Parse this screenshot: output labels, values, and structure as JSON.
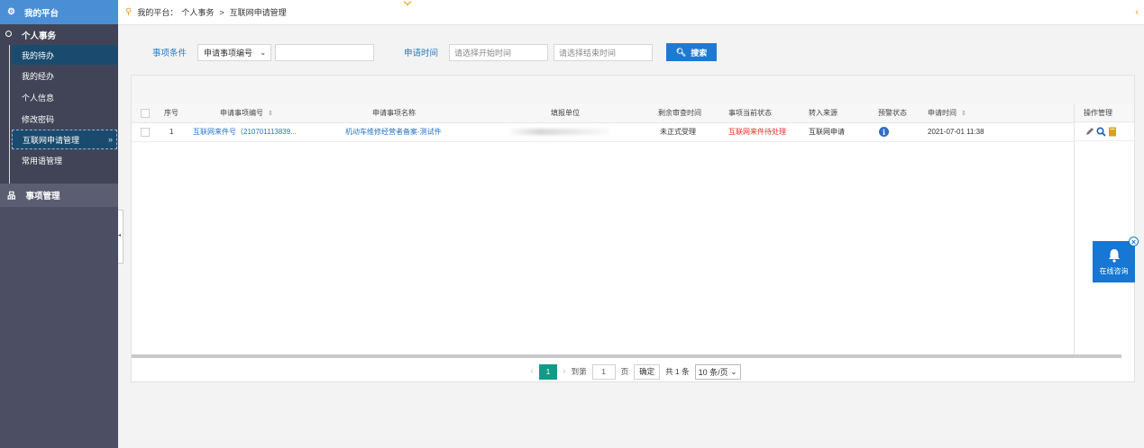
{
  "sidebar": {
    "platform": "我的平台",
    "group1": {
      "title": "个人事务",
      "items": [
        {
          "label": "我的待办"
        },
        {
          "label": "我的经办"
        },
        {
          "label": "个人信息"
        },
        {
          "label": "修改密码"
        },
        {
          "label": "互联网申请管理",
          "arrow": "»"
        },
        {
          "label": "常用语管理"
        }
      ]
    },
    "group2": {
      "title": "事项管理"
    }
  },
  "breadcrumb": {
    "root": "我的平台：",
    "level1": "个人事务",
    "separator": ">",
    "level2": "互联网申请管理",
    "back_icon": "‹"
  },
  "search": {
    "condition_label": "事项条件",
    "condition_select": "申请事项编号",
    "condition_value": "",
    "time_label": "申请时间",
    "start_placeholder": "请选择开始时间",
    "end_placeholder": "请选择结束时间",
    "search_button": "搜索"
  },
  "table": {
    "headers": {
      "index": "序号",
      "code": "申请事项编号",
      "name": "申请事项名称",
      "unit": "填报单位",
      "remaining": "剩余审查时间",
      "status": "事项当前状态",
      "source": "转入来源",
      "warning": "预警状态",
      "time": "申请时间",
      "ops": "操作管理"
    },
    "sort_icon": "⇕",
    "rows": [
      {
        "index": "1",
        "code": "互联网来件号（210701113839...",
        "name": "机动车维修经营者备案-测试件",
        "remaining": "未正式受理",
        "status": "互联网来件待处理",
        "source": "互联网申请",
        "warning_icon": "i",
        "time": "2021-07-01 11:38"
      }
    ]
  },
  "pager": {
    "prev": "‹",
    "current": "1",
    "next": "›",
    "goto_label": "到第",
    "goto_value": "1",
    "page_unit": "页",
    "confirm": "确定",
    "total": "共 1 条",
    "page_size": "10 条/页"
  },
  "consult": {
    "label": "在线咨询",
    "close": "×"
  },
  "colors": {
    "sidebar_bg": "#4c4f63",
    "accent_blue": "#1e79d3",
    "pager_current": "#119a88",
    "status_red": "#e8302a"
  }
}
